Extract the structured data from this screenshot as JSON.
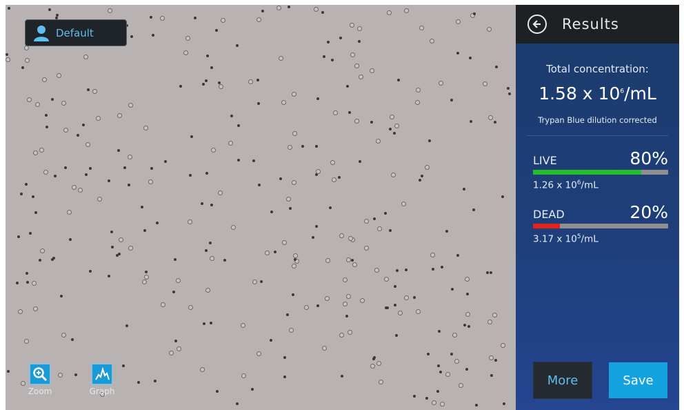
{
  "profile": {
    "label": "Default",
    "icon": "user-icon"
  },
  "tools": [
    {
      "label": "Zoom",
      "icon": "zoom-in-icon"
    },
    {
      "label": "Graph",
      "icon": "graph-icon"
    }
  ],
  "panel": {
    "title": "Results",
    "back_icon": "back-arrow-icon",
    "total_label": "Total concentration:",
    "total_base": "1.58 x 10",
    "total_exp": "6",
    "total_unit": "/mL",
    "dilution_note": "Trypan Blue dilution corrected",
    "live": {
      "label": "LIVE",
      "percent_text": "80%",
      "fraction": 0.8,
      "color": "#24bd2c",
      "conc_base": "1.26 x 10",
      "conc_exp": "6",
      "conc_unit": "/mL"
    },
    "dead": {
      "label": "DEAD",
      "percent_text": "20%",
      "fraction": 0.2,
      "color": "#e2231a",
      "conc_base": "3.17 x 10",
      "conc_exp": "5",
      "conc_unit": "/mL"
    }
  },
  "buttons": {
    "more": "More",
    "save": "Save"
  },
  "colors": {
    "accent": "#14a2e0",
    "panel_bg": "#1e3f7b",
    "header_bg": "#1e2124",
    "image_bg": "#b9b2b2"
  }
}
